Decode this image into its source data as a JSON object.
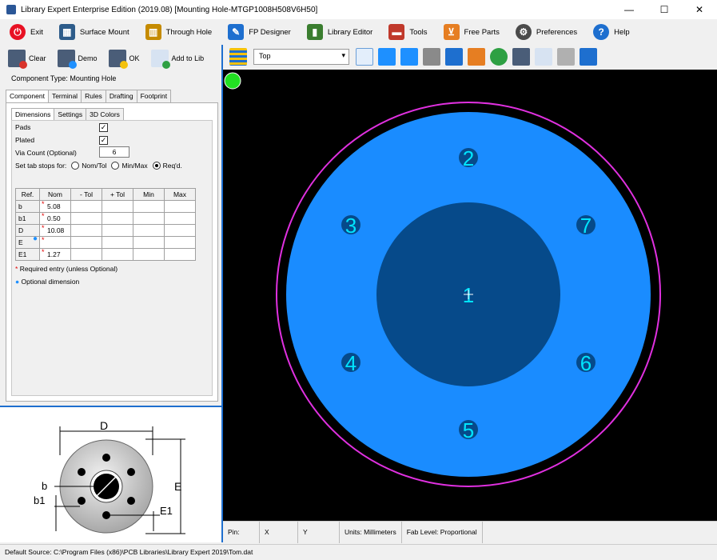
{
  "window": {
    "title": "Library Expert Enterprise Edition (2019.08) [Mounting Hole-MTGP1008H508V6H50]",
    "minimize": "—",
    "maximize": "☐",
    "close": "✕"
  },
  "menu": [
    {
      "label": "Exit",
      "icon": "power-icon",
      "color": "#e81123"
    },
    {
      "label": "Surface Mount",
      "icon": "chip-icon",
      "color": "#2d5c8a"
    },
    {
      "label": "Through Hole",
      "icon": "through-hole-icon",
      "color": "#c58b00"
    },
    {
      "label": "FP Designer",
      "icon": "fp-designer-icon",
      "color": "#1e6fcf"
    },
    {
      "label": "Library Editor",
      "icon": "books-icon",
      "color": "#3a7d2f"
    },
    {
      "label": "Tools",
      "icon": "toolbox-icon",
      "color": "#c0392b"
    },
    {
      "label": "Free Parts",
      "icon": "cart-icon",
      "color": "#e67e22"
    },
    {
      "label": "Preferences",
      "icon": "gear-icon",
      "color": "#4a4a4a"
    },
    {
      "label": "Help",
      "icon": "help-icon",
      "color": "#1e6fcf"
    }
  ],
  "left_toolbar": [
    {
      "label": "Clear",
      "icon": "clear-icon",
      "badge": "#d9342b"
    },
    {
      "label": "Demo",
      "icon": "demo-icon",
      "badge": "#1e90ff"
    },
    {
      "label": "OK",
      "icon": "ok-icon",
      "badge": "#f4c20d"
    },
    {
      "label": "Add to Lib",
      "icon": "add-to-lib-icon",
      "badge": "#2ea043"
    }
  ],
  "component_type": "Component Type: Mounting Hole",
  "tabs": [
    "Component",
    "Terminal",
    "Rules",
    "Drafting",
    "Footprint"
  ],
  "subtabs": [
    "Dimensions",
    "Settings",
    "3D Colors"
  ],
  "form": {
    "pads_label": "Pads",
    "pads_checked": "✓",
    "plated_label": "Plated",
    "plated_checked": "✓",
    "via_label": "Via Count (Optional)",
    "via_value": "6",
    "tabstops_label": "Set tab stops for:",
    "opt_nomtol": "Nom/Tol",
    "opt_minmax": "Min/Max",
    "opt_reqd": "Req'd."
  },
  "table": {
    "headers": [
      "Ref.",
      "Nom",
      "- Tol",
      "+ Tol",
      "Min",
      "Max"
    ],
    "rows": [
      {
        "ref": "b",
        "nom": "5.08"
      },
      {
        "ref": "b1",
        "nom": "0.50"
      },
      {
        "ref": "D",
        "nom": "10.08"
      },
      {
        "ref": "E",
        "nom": ""
      },
      {
        "ref": "E1",
        "nom": "1.27"
      }
    ]
  },
  "legend": {
    "required": "Required entry (unless Optional)",
    "optional": "Optional dimension",
    "star": "*",
    "dot": "●"
  },
  "preview": {
    "labels": {
      "D": "D",
      "E": "E",
      "b": "b",
      "b1": "b1",
      "E1": "E1"
    }
  },
  "right_toolbar": {
    "layer": "Top"
  },
  "canvas": {
    "pads": [
      "1",
      "2",
      "3",
      "4",
      "5",
      "6",
      "7"
    ],
    "colors": {
      "pad": "#1a8cff",
      "hole": "#064a8a",
      "courtyard": "#e030e0",
      "label": "#00e5ff"
    }
  },
  "status": {
    "pin": "Pin:",
    "x": "X",
    "y": "Y",
    "units": "Units: Millimeters",
    "fab": "Fab Level: Proportional"
  },
  "source": "Default Source:  C:\\Program Files (x86)\\PCB Libraries\\Library Expert 2019\\Tom.dat"
}
